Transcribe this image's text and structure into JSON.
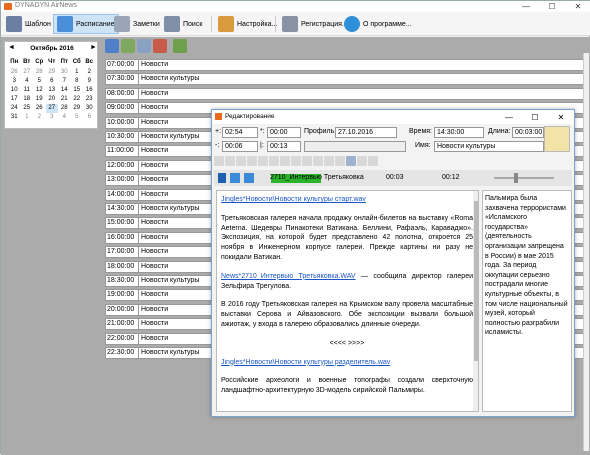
{
  "app": {
    "title": "DYNADYN AirNews"
  },
  "toolbar": {
    "template": "Шаблон",
    "schedule": "Расписание",
    "notes": "Заметки",
    "search": "Поиск",
    "settings": "Настройка...",
    "register": "Регистрация...",
    "about": "О программе..."
  },
  "calendar": {
    "month": "Октябрь 2016",
    "prev": "◄",
    "next": "►",
    "weekdays": [
      "Пн",
      "Вт",
      "Ср",
      "Чт",
      "Пт",
      "Сб",
      "Вс"
    ],
    "weeks": [
      [
        "26",
        "27",
        "28",
        "29",
        "30",
        "1",
        "2"
      ],
      [
        "3",
        "4",
        "5",
        "6",
        "7",
        "8",
        "9"
      ],
      [
        "10",
        "11",
        "12",
        "13",
        "14",
        "15",
        "16"
      ],
      [
        "17",
        "18",
        "19",
        "20",
        "21",
        "22",
        "23"
      ],
      [
        "24",
        "25",
        "26",
        "27",
        "28",
        "29",
        "30"
      ],
      [
        "31",
        "1",
        "2",
        "3",
        "4",
        "5",
        "6"
      ]
    ]
  },
  "schedule": [
    {
      "time": "07:00:00",
      "title": "Новости"
    },
    {
      "time": "07:30:00",
      "title": "Новости культуры"
    },
    {
      "time": "08:00:00",
      "title": "Новости"
    },
    {
      "time": "09:00:00",
      "title": "Новости"
    },
    {
      "time": "10:00:00",
      "title": "Новости"
    },
    {
      "time": "10:30:00",
      "title": "Новости культуры"
    },
    {
      "time": "11:00:00",
      "title": "Новости"
    },
    {
      "time": "12:00:00",
      "title": "Новости"
    },
    {
      "time": "13:00:00",
      "title": "Новости"
    },
    {
      "time": "14:00:00",
      "title": "Новости"
    },
    {
      "time": "14:30:00",
      "title": "Новости культуры"
    },
    {
      "time": "15:00:00",
      "title": "Новости"
    },
    {
      "time": "16:00:00",
      "title": "Новости"
    },
    {
      "time": "17:00:00",
      "title": "Новости"
    },
    {
      "time": "18:00:00",
      "title": "Новости"
    },
    {
      "time": "18:30:00",
      "title": "Новости культуры"
    },
    {
      "time": "19:00:00",
      "title": "Новости"
    },
    {
      "time": "20:00:00",
      "title": "Новости"
    },
    {
      "time": "21:00:00",
      "title": "Новости"
    },
    {
      "time": "22:00:00",
      "title": "Новости"
    },
    {
      "time": "22:30:00",
      "title": "Новости культуры"
    }
  ],
  "editor": {
    "title": "Редактирование",
    "plus_label": "+:",
    "plus_value": "02:54",
    "star_label": "*:",
    "star_value": "00:00",
    "profile_label": "Профиль:",
    "profile_value": "27.10.2016",
    "time_label": "Время:",
    "time_value": "14:30:00",
    "length_label": "Длина:",
    "length_value": "00:03:00",
    "minus_label": "-:",
    "minus_value": "00:06",
    "bar_label": "|:",
    "bar_value": "00:13",
    "name_label": "Имя:",
    "name_value": "Новости культуры",
    "player_track": "2710_Интервью Третьяковка",
    "player_pos": "00:03",
    "player_len": "00:12",
    "paragraphs": [
      {
        "link": "Jingles*Новости\\Новости культуры старт.wav",
        "text": ""
      },
      {
        "link": "",
        "text": "Третьяковская галерея начала продажу онлайн-билетов на выставку «Roma Aeterna. Шедевры Пинакотеки Ватикана. Беллини, Рафаэль, Караваджо». Экспозиция, на которой будет представлено 42 полотна, откроется 25 ноября в Инженерном корпусе галереи. Прежде картины ни разу не покидали Ватикан."
      },
      {
        "link": "News*2710_Интервью Третьяковка.WAV",
        "text": " — сообщила директор галереи Зельфира Трегулова."
      },
      {
        "link": "",
        "text": "В 2016 году Третьяковская галерея на Крымском валу провела масштабные выставки Серова и Айвазовского. Обе экспозиции вызвали большой ажиотаж, у входа в галерею образовались длинные очереди."
      },
      {
        "link": "",
        "text": "<<<< >>>>",
        "center": true
      },
      {
        "link": "Jingles*Новости\\Новости культуры разделитель.wav",
        "text": ""
      },
      {
        "link": "",
        "text": "Российские археологи и военные топографы создали сверхточную ландшафтно-архитектурную 3D-модель сирийской Пальмиры."
      }
    ],
    "side_text": "Пальмира была захвачена террористами «Исламского государства» (деятельность организации запрещена в России) в мае 2015 года. За период оккупации серьезно пострадали многие культурные объекты, в том числе национальный музей, который полностью разграбили исламисты."
  }
}
